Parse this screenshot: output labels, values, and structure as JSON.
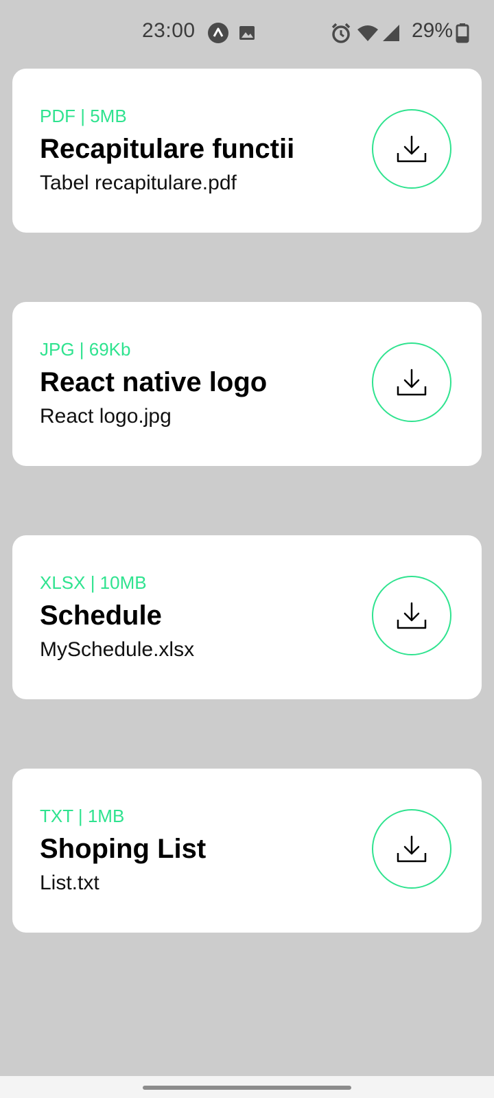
{
  "status_bar": {
    "time": "23:00",
    "battery": "29%",
    "icons": [
      "app-notification-icon",
      "image-icon",
      "alarm-icon",
      "wifi-icon",
      "signal-icon",
      "battery-icon"
    ]
  },
  "colors": {
    "accent": "#2fe38f",
    "background": "#cccccc",
    "card": "#ffffff"
  },
  "files": [
    {
      "meta": "PDF | 5MB",
      "title": "Recapitulare functii",
      "filename": "Tabel recapitulare.pdf",
      "icon": "download-icon"
    },
    {
      "meta": "JPG | 69Kb",
      "title": "React native logo",
      "filename": "React logo.jpg",
      "icon": "download-icon"
    },
    {
      "meta": "XLSX | 10MB",
      "title": "Schedule",
      "filename": "MySchedule.xlsx",
      "icon": "download-icon"
    },
    {
      "meta": "TXT | 1MB",
      "title": "Shoping List",
      "filename": "List.txt",
      "icon": "download-icon"
    }
  ]
}
